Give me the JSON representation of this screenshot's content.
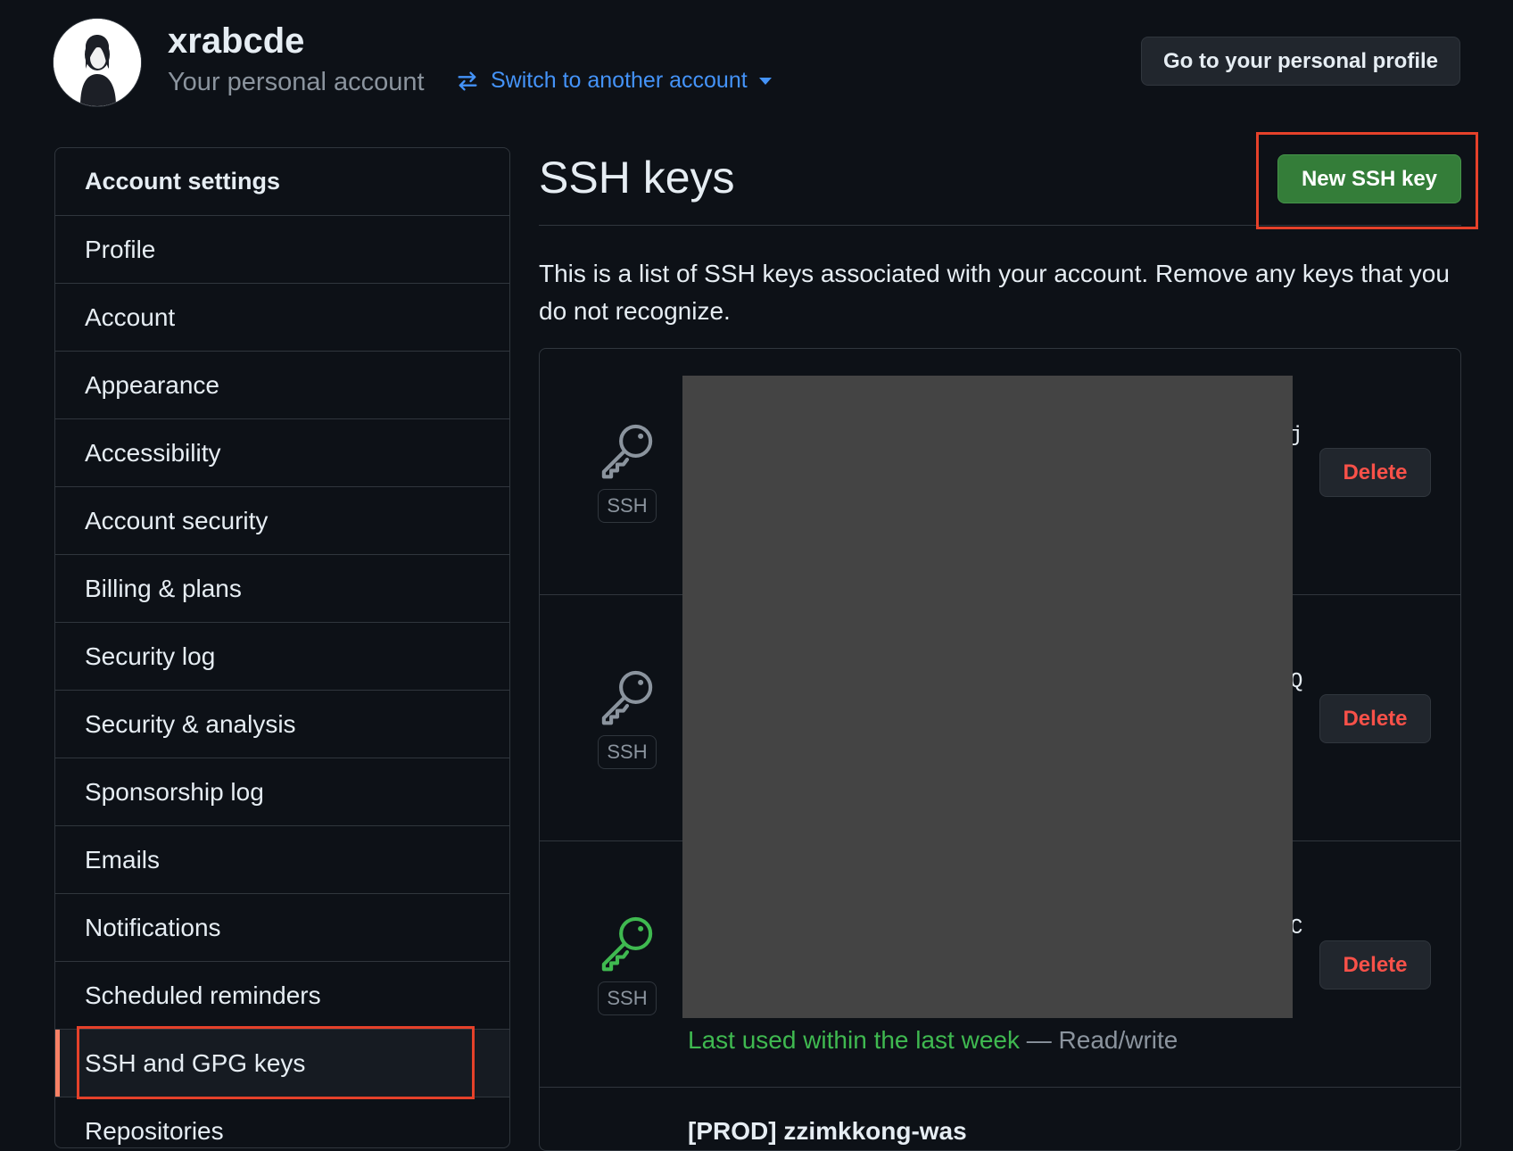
{
  "header": {
    "username": "xrabcde",
    "subtitle": "Your personal account",
    "switch_label": "Switch to another account",
    "profile_button": "Go to your personal profile"
  },
  "sidebar": {
    "heading": "Account settings",
    "items": [
      {
        "label": "Profile"
      },
      {
        "label": "Account"
      },
      {
        "label": "Appearance"
      },
      {
        "label": "Accessibility"
      },
      {
        "label": "Account security"
      },
      {
        "label": "Billing & plans"
      },
      {
        "label": "Security log"
      },
      {
        "label": "Security & analysis"
      },
      {
        "label": "Sponsorship log"
      },
      {
        "label": "Emails"
      },
      {
        "label": "Notifications"
      },
      {
        "label": "Scheduled reminders"
      },
      {
        "label": "SSH and GPG keys",
        "active": true
      },
      {
        "label": "Repositories"
      }
    ]
  },
  "main": {
    "title": "SSH keys",
    "new_key_button": "New SSH key",
    "description": "This is a list of SSH keys associated with your account. Remove any keys that you do not recognize.",
    "keys": [
      {
        "badge": "SSH",
        "fragment": "j",
        "delete_label": "Delete",
        "icon": "key-icon",
        "icon_color": "#8b949e"
      },
      {
        "badge": "SSH",
        "fragment": "Q",
        "delete_label": "Delete",
        "icon": "key-icon",
        "icon_color": "#8b949e"
      },
      {
        "badge": "SSH",
        "fragment": "C",
        "delete_label": "Delete",
        "icon": "key-icon",
        "icon_color": "#3fb950"
      }
    ],
    "last_used_text": "Last used within the last week",
    "access_text": " — Read/write",
    "partial_next_key": "[PROD] zzimkkong-was"
  },
  "colors": {
    "accent_link": "#4493f8",
    "primary_button": "#347d39",
    "danger": "#f85149",
    "annotation_outline": "#e5412a"
  }
}
